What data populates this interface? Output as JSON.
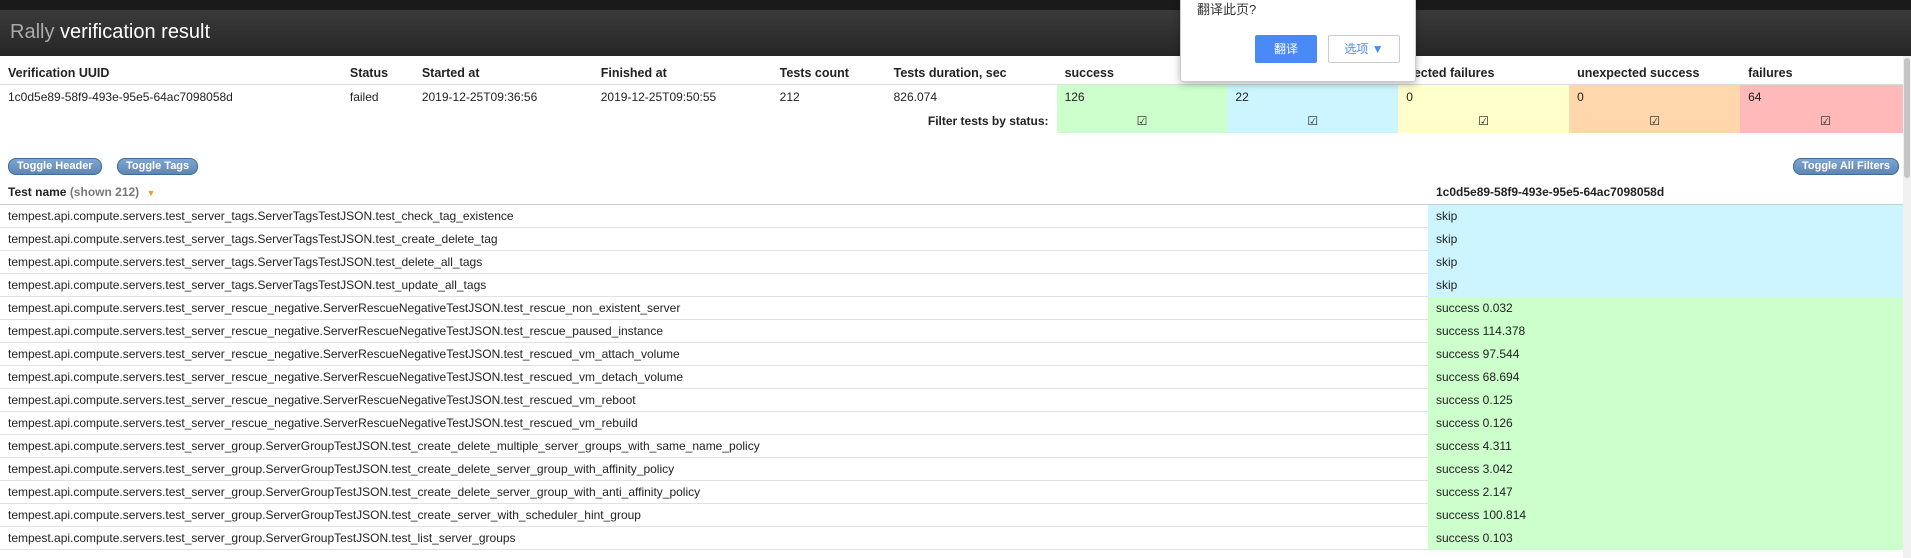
{
  "header": {
    "brand": "Rally",
    "title": "verification result"
  },
  "summary": {
    "columns": [
      "Verification UUID",
      "Status",
      "Started at",
      "Finished at",
      "Tests count",
      "Tests duration, sec",
      "success",
      "",
      "pected failures",
      "unexpected success",
      "failures"
    ],
    "row": {
      "uuid": "1c0d5e89-58f9-493e-95e5-64ac7098058d",
      "status": "failed",
      "started": "2019-12-25T09:36:56",
      "finished": "2019-12-25T09:50:55",
      "count": "212",
      "duration": "826.074",
      "success": "126",
      "skip": "22",
      "xfail": "0",
      "uxsucc": "0",
      "failures": "64"
    },
    "filter_label": "Filter tests by status:",
    "check": "☑"
  },
  "buttons": {
    "toggle_header": "Toggle Header",
    "toggle_tags": "Toggle Tags",
    "toggle_filters": "Toggle All Filters"
  },
  "tests_header": {
    "name": "Test name",
    "shown": "(shown 212)",
    "caret": "▼",
    "uuid": "1c0d5e89-58f9-493e-95e5-64ac7098058d"
  },
  "tests": [
    {
      "name": "tempest.api.compute.servers.test_server_tags.ServerTagsTestJSON.test_check_tag_existence",
      "result": "skip",
      "status": "skip"
    },
    {
      "name": "tempest.api.compute.servers.test_server_tags.ServerTagsTestJSON.test_create_delete_tag",
      "result": "skip",
      "status": "skip"
    },
    {
      "name": "tempest.api.compute.servers.test_server_tags.ServerTagsTestJSON.test_delete_all_tags",
      "result": "skip",
      "status": "skip"
    },
    {
      "name": "tempest.api.compute.servers.test_server_tags.ServerTagsTestJSON.test_update_all_tags",
      "result": "skip",
      "status": "skip"
    },
    {
      "name": "tempest.api.compute.servers.test_server_rescue_negative.ServerRescueNegativeTestJSON.test_rescue_non_existent_server",
      "result": "success 0.032",
      "status": "success"
    },
    {
      "name": "tempest.api.compute.servers.test_server_rescue_negative.ServerRescueNegativeTestJSON.test_rescue_paused_instance",
      "result": "success 114.378",
      "status": "success"
    },
    {
      "name": "tempest.api.compute.servers.test_server_rescue_negative.ServerRescueNegativeTestJSON.test_rescued_vm_attach_volume",
      "result": "success 97.544",
      "status": "success"
    },
    {
      "name": "tempest.api.compute.servers.test_server_rescue_negative.ServerRescueNegativeTestJSON.test_rescued_vm_detach_volume",
      "result": "success 68.694",
      "status": "success"
    },
    {
      "name": "tempest.api.compute.servers.test_server_rescue_negative.ServerRescueNegativeTestJSON.test_rescued_vm_reboot",
      "result": "success 0.125",
      "status": "success"
    },
    {
      "name": "tempest.api.compute.servers.test_server_rescue_negative.ServerRescueNegativeTestJSON.test_rescued_vm_rebuild",
      "result": "success 0.126",
      "status": "success"
    },
    {
      "name": "tempest.api.compute.servers.test_server_group.ServerGroupTestJSON.test_create_delete_multiple_server_groups_with_same_name_policy",
      "result": "success 4.311",
      "status": "success"
    },
    {
      "name": "tempest.api.compute.servers.test_server_group.ServerGroupTestJSON.test_create_delete_server_group_with_affinity_policy",
      "result": "success 3.042",
      "status": "success"
    },
    {
      "name": "tempest.api.compute.servers.test_server_group.ServerGroupTestJSON.test_create_delete_server_group_with_anti_affinity_policy",
      "result": "success 2.147",
      "status": "success"
    },
    {
      "name": "tempest.api.compute.servers.test_server_group.ServerGroupTestJSON.test_create_server_with_scheduler_hint_group",
      "result": "success 100.814",
      "status": "success"
    },
    {
      "name": "tempest.api.compute.servers.test_server_group.ServerGroupTestJSON.test_list_server_groups",
      "result": "success 0.103",
      "status": "success"
    }
  ],
  "popup": {
    "message": "翻译此页?",
    "translate": "翻译",
    "options": "选项 ▼"
  }
}
